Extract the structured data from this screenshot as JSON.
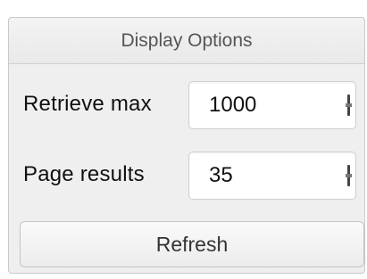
{
  "panel": {
    "title": "Display Options"
  },
  "retrieve_max": {
    "label": "Retrieve max",
    "value": "1000"
  },
  "page_results": {
    "label": "Page results",
    "value": "35"
  },
  "actions": {
    "refresh_label": "Refresh"
  }
}
